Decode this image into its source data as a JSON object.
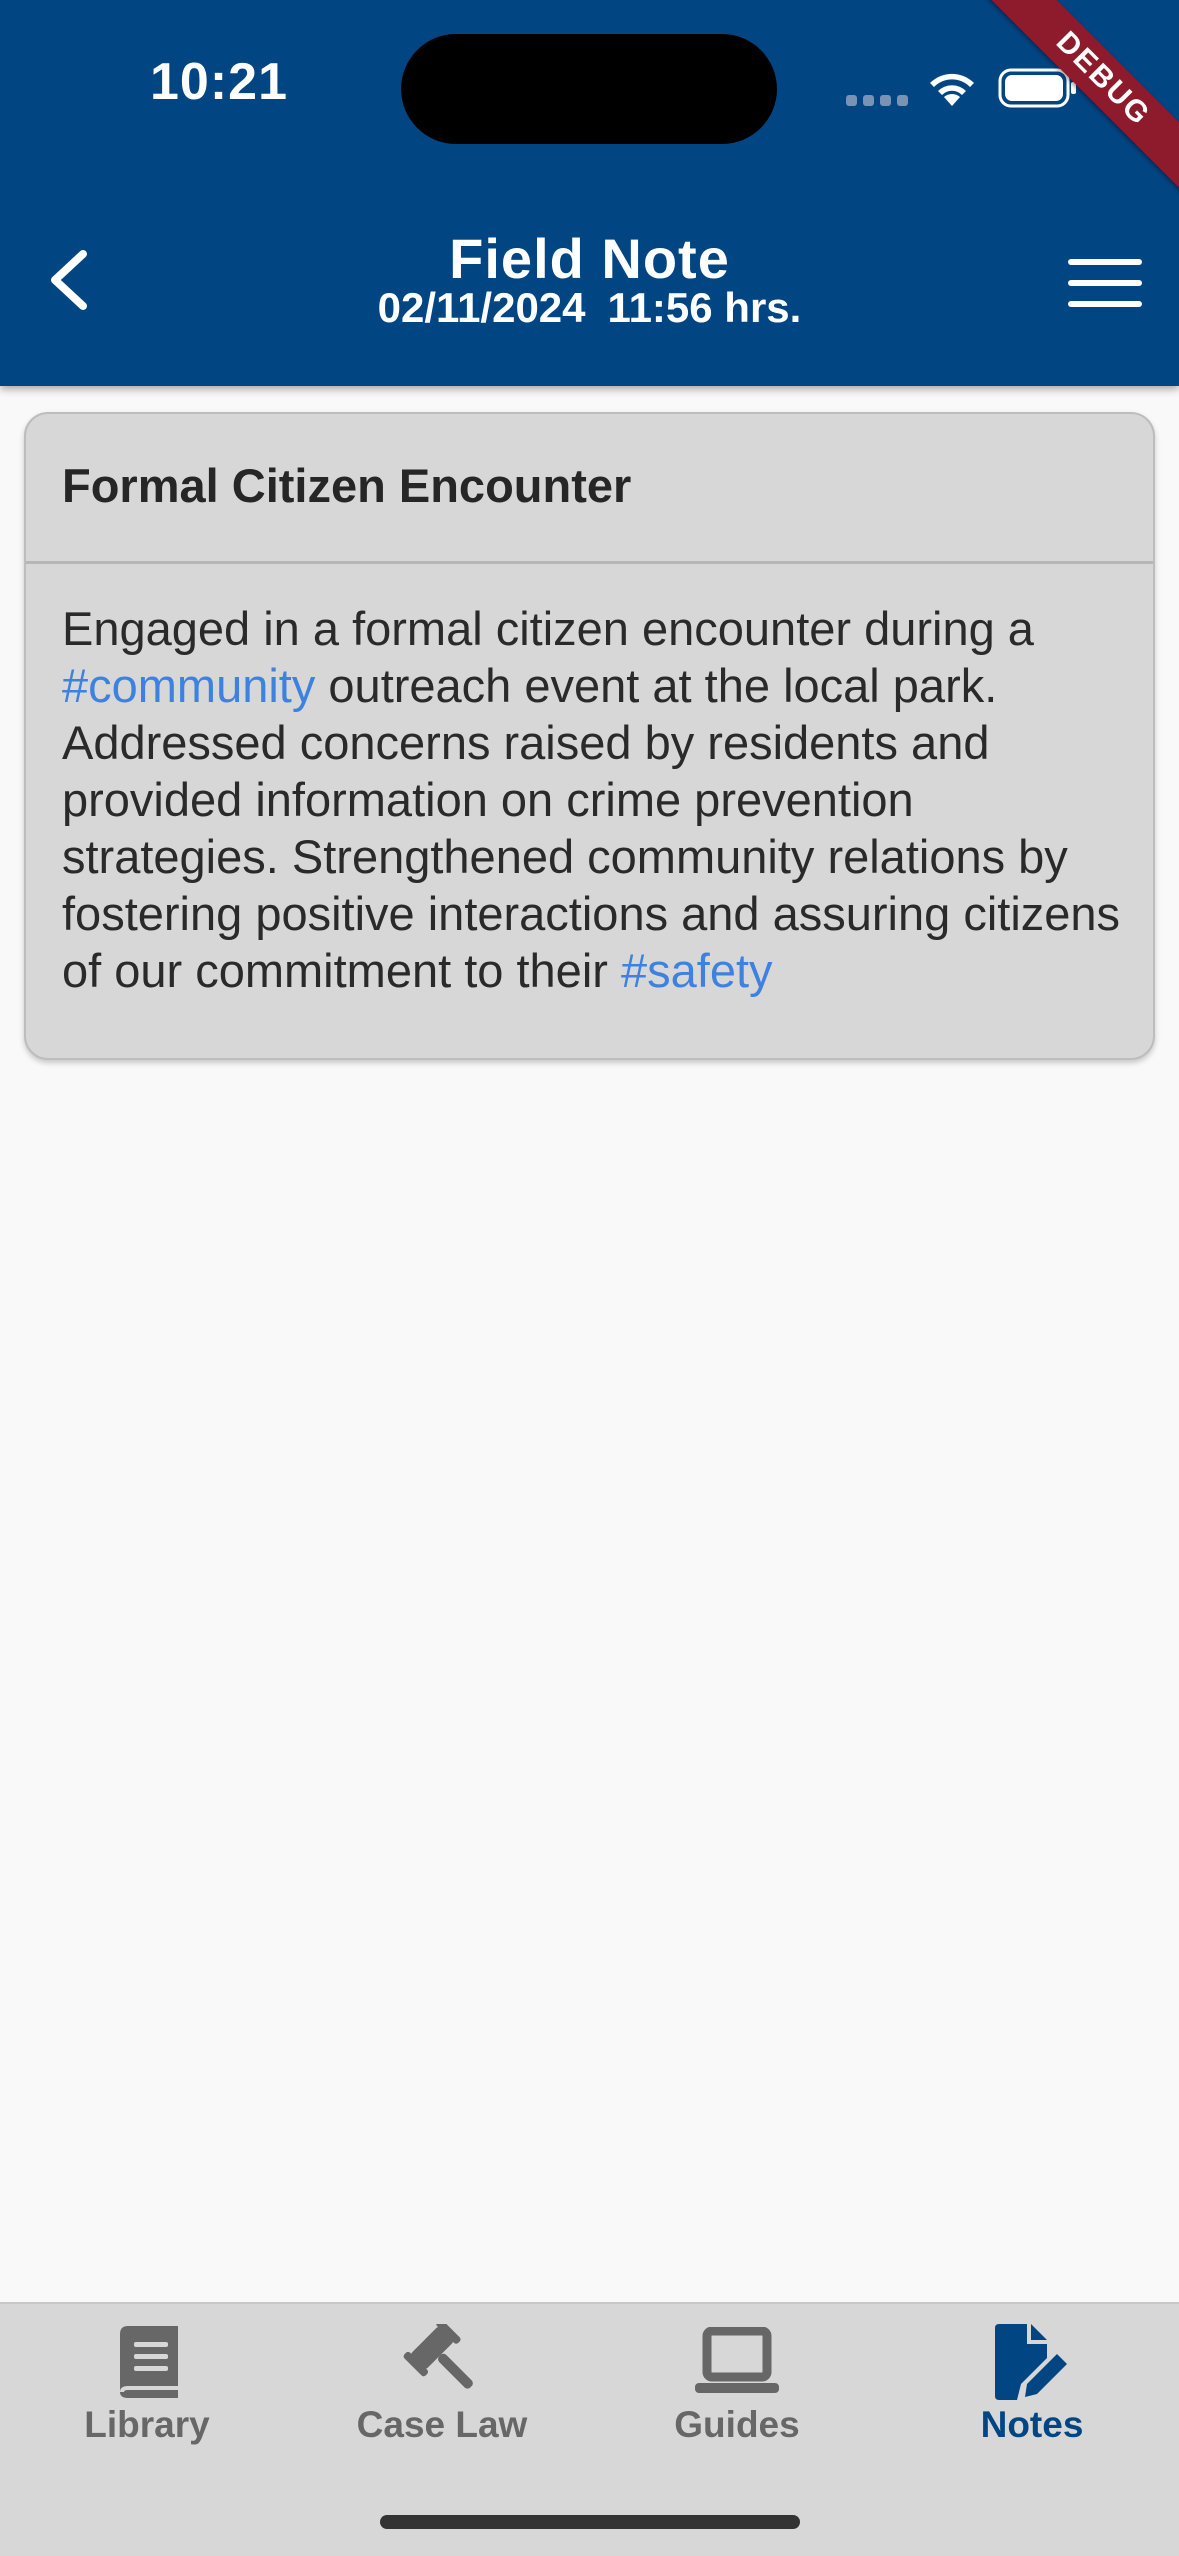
{
  "status_bar": {
    "time": "10:21",
    "debug_label": "DEBUG"
  },
  "header": {
    "title": "Field Note",
    "date": "02/11/2024",
    "time": "11:56 hrs.",
    "back_icon": "chevron-left-icon",
    "menu_icon": "hamburger-menu-icon",
    "background_color": "#014683"
  },
  "note": {
    "title": "Formal Citizen Encounter",
    "body": [
      {
        "text": "Engaged in a formal citizen encounter during a ",
        "tag": false
      },
      {
        "text": "#community",
        "tag": true
      },
      {
        "text": " outreach event at the local park. Addressed concerns raised by residents and provided information on crime prevention strategies. Strengthened community relations by fostering positive interactions and assuring citizens of our commitment to their ",
        "tag": false
      },
      {
        "text": "#safety",
        "tag": true
      }
    ],
    "hashtag_color": "#3d82e0"
  },
  "bottom_nav": {
    "items": [
      {
        "label": "Library",
        "icon": "book-icon",
        "active": false
      },
      {
        "label": "Case Law",
        "icon": "gavel-icon",
        "active": false
      },
      {
        "label": "Guides",
        "icon": "laptop-icon",
        "active": false
      },
      {
        "label": "Notes",
        "icon": "note-edit-icon",
        "active": true
      }
    ],
    "active_color": "#014683",
    "inactive_color": "#676767"
  }
}
